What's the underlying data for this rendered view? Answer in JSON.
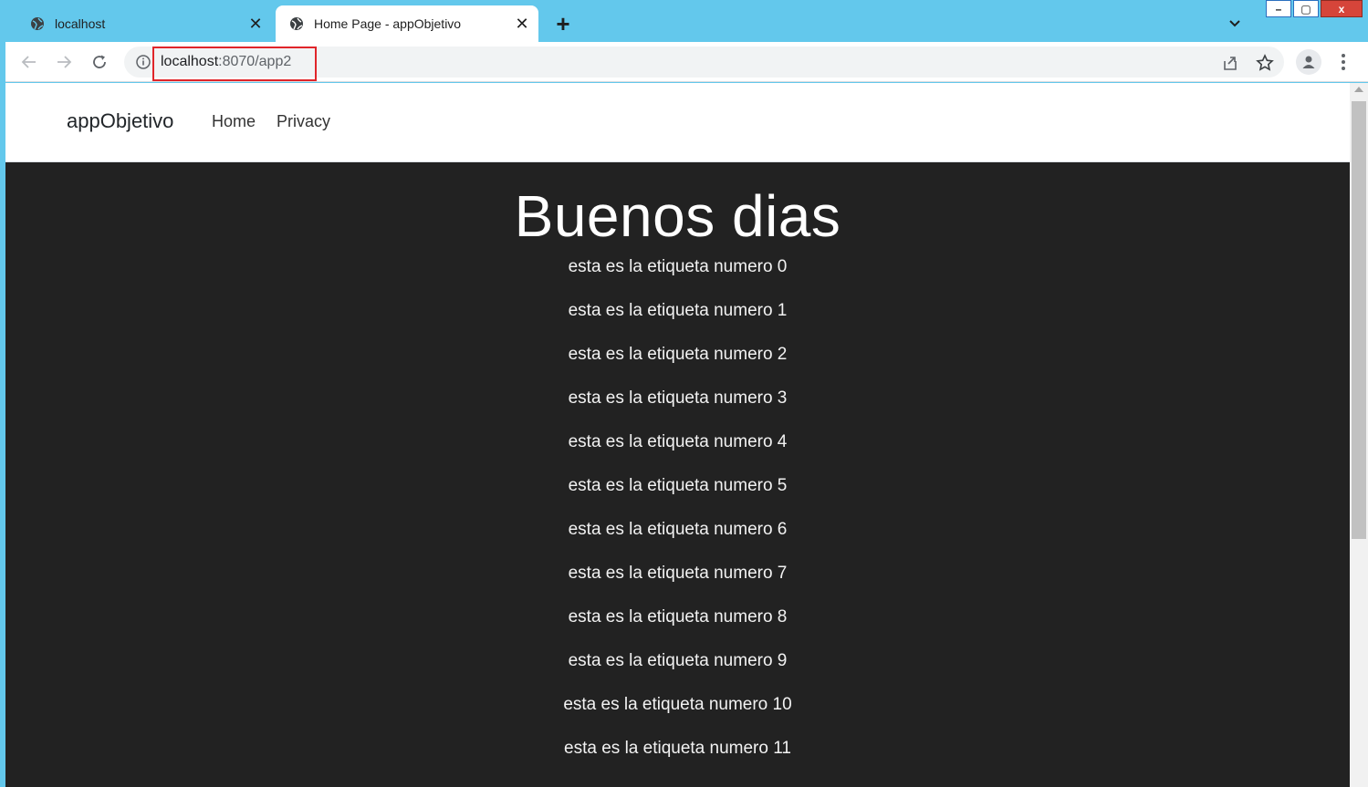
{
  "browser": {
    "tabs": [
      {
        "title": "localhost",
        "active": false,
        "icon": "globe-icon",
        "close": "✕"
      },
      {
        "title": "Home Page - appObjetivo",
        "active": true,
        "icon": "globe-icon",
        "close": "✕"
      }
    ],
    "new_tab": "+",
    "url_host": "localhost",
    "url_rest": ":8070/app2",
    "window_controls": {
      "minimize": "–",
      "maximize": "▢",
      "close": "x"
    }
  },
  "site": {
    "brand": "appObjetivo",
    "nav": {
      "home": "Home",
      "privacy": "Privacy"
    }
  },
  "main": {
    "heading": "Buenos dias",
    "labels": [
      "esta es la etiqueta numero 0",
      "esta es la etiqueta numero 1",
      "esta es la etiqueta numero 2",
      "esta es la etiqueta numero 3",
      "esta es la etiqueta numero 4",
      "esta es la etiqueta numero 5",
      "esta es la etiqueta numero 6",
      "esta es la etiqueta numero 7",
      "esta es la etiqueta numero 8",
      "esta es la etiqueta numero 9",
      "esta es la etiqueta numero 10",
      "esta es la etiqueta numero 11"
    ]
  },
  "colors": {
    "titlebar": "#63c8ec",
    "page_background": "#222222",
    "url_highlight": "#e0252a"
  }
}
